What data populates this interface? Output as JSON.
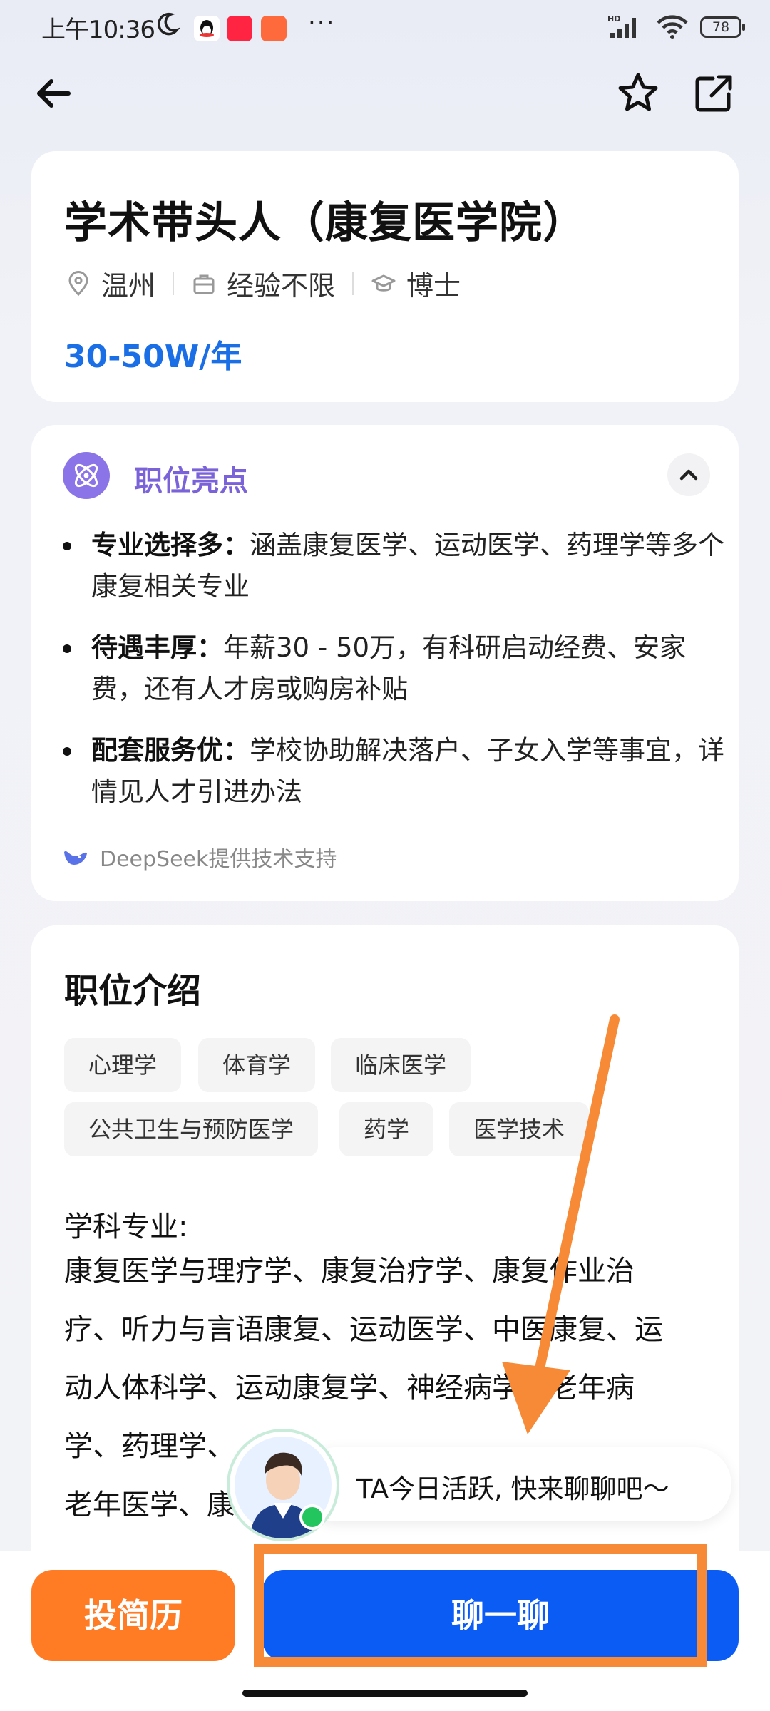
{
  "status_bar": {
    "time": "上午10:36",
    "network": "HD",
    "battery": "78",
    "more": "···"
  },
  "nav": {
    "back_icon": "arrow-left-icon",
    "favorite_icon": "star-outline-icon",
    "share_icon": "share-edit-icon"
  },
  "job": {
    "title": "学术带头人（康复医学院）",
    "location": "温州",
    "experience": "经验不限",
    "education": "博士",
    "salary": "30-50W/年"
  },
  "highlights": {
    "title": "职位亮点",
    "items": [
      {
        "label": "专业选择多：",
        "text": "涵盖康复医学、运动医学、药理学等多个康复相关专业"
      },
      {
        "label": "待遇丰厚：",
        "text": "年薪30 - 50万，有科研启动经费、安家费，还有人才房或购房补贴"
      },
      {
        "label": "配套服务优：",
        "text": "学校协助解决落户、子女入学等事宜，详情见人才引进办法"
      }
    ],
    "powered_by": "DeepSeek提供技术支持"
  },
  "intro": {
    "title": "职位介绍",
    "tags": [
      "心理学",
      "体育学",
      "临床医学",
      "公共卫生与预防医学",
      "药学",
      "医学技术"
    ],
    "field_label": "学科专业:",
    "field_lines": [
      "康复医学与理疗学、康复治疗学、康复作业治",
      "疗、听力与言语康复、运动医学、中医康复、运",
      "动人体科学、运动康复学、神经病学、老年病",
      "学、药理学、",
      "老年医学、康复物理治疗、应用心理学等康复相"
    ]
  },
  "chat_prompt": "TA今日活跃, 快来聊聊吧～",
  "actions": {
    "resume": "投简历",
    "chat": "聊一聊"
  },
  "colors": {
    "salary": "#1a6ee6",
    "highlight_accent": "#7a63d9",
    "resume_button": "#ff7b24",
    "chat_button": "#0a5cf5",
    "annotation": "#f78a36"
  }
}
